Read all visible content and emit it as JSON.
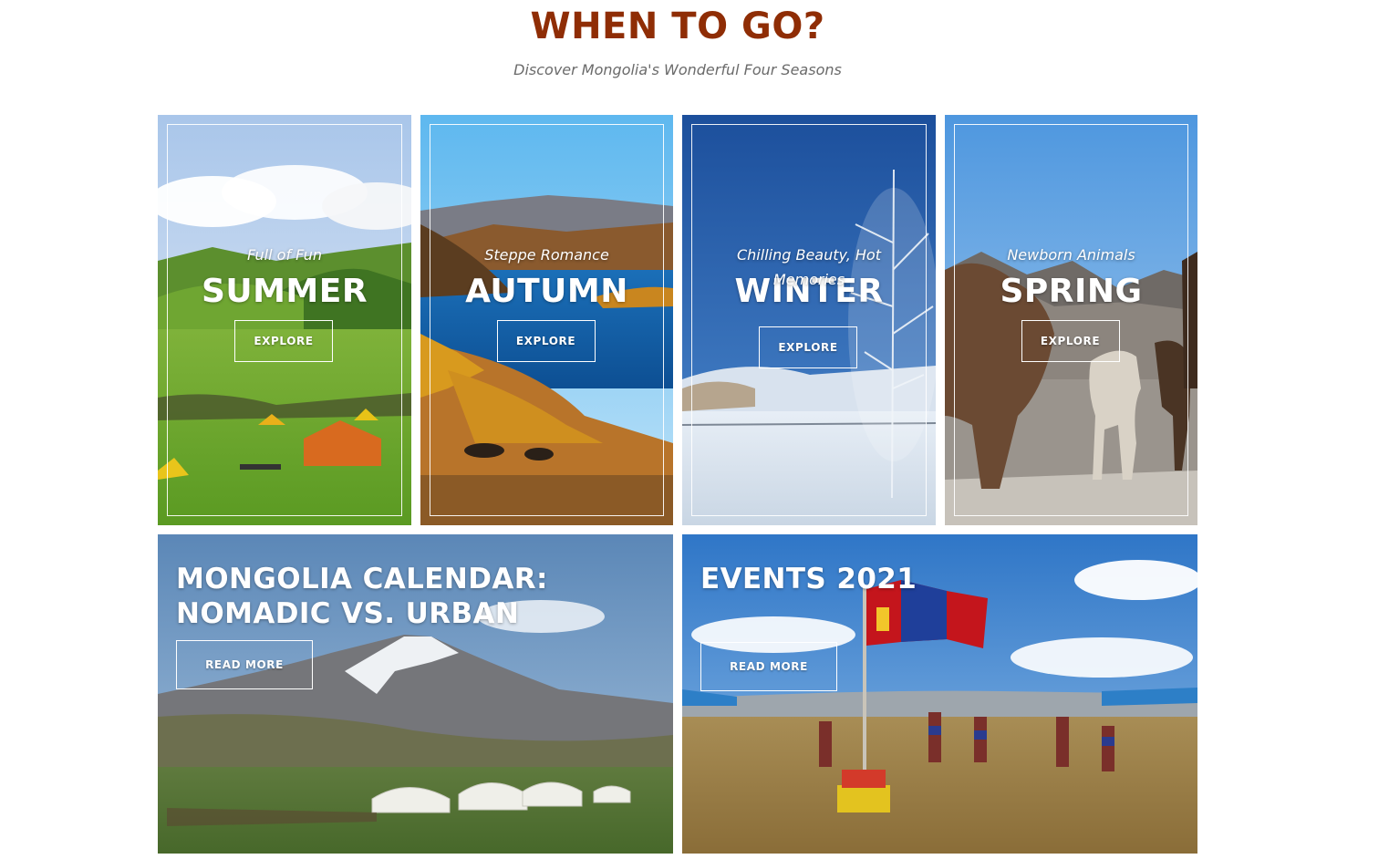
{
  "header": {
    "title": "WHEN TO GO?",
    "subtitle": "Discover Mongolia's Wonderful Four Seasons"
  },
  "seasons": [
    {
      "title": "SUMMER",
      "subtitle": "Full of Fun",
      "button": "EXPLORE"
    },
    {
      "title": "AUTUMN",
      "subtitle": "Steppe Romance",
      "button": "EXPLORE"
    },
    {
      "title": "WINTER",
      "subtitle": "Chilling Beauty, Hot Memories",
      "button": "EXPLORE"
    },
    {
      "title": "SPRING",
      "subtitle": "Newborn Animals",
      "button": "EXPLORE"
    }
  ],
  "features": [
    {
      "title": "MONGOLIA CALENDAR: NOMADIC VS. URBAN",
      "button": "READ MORE"
    },
    {
      "title": "EVENTS 2021",
      "button": "READ MORE"
    }
  ],
  "colors": {
    "title": "#8f2d05",
    "subtitle": "#6b6b6b",
    "overlay_text": "#ffffff"
  }
}
